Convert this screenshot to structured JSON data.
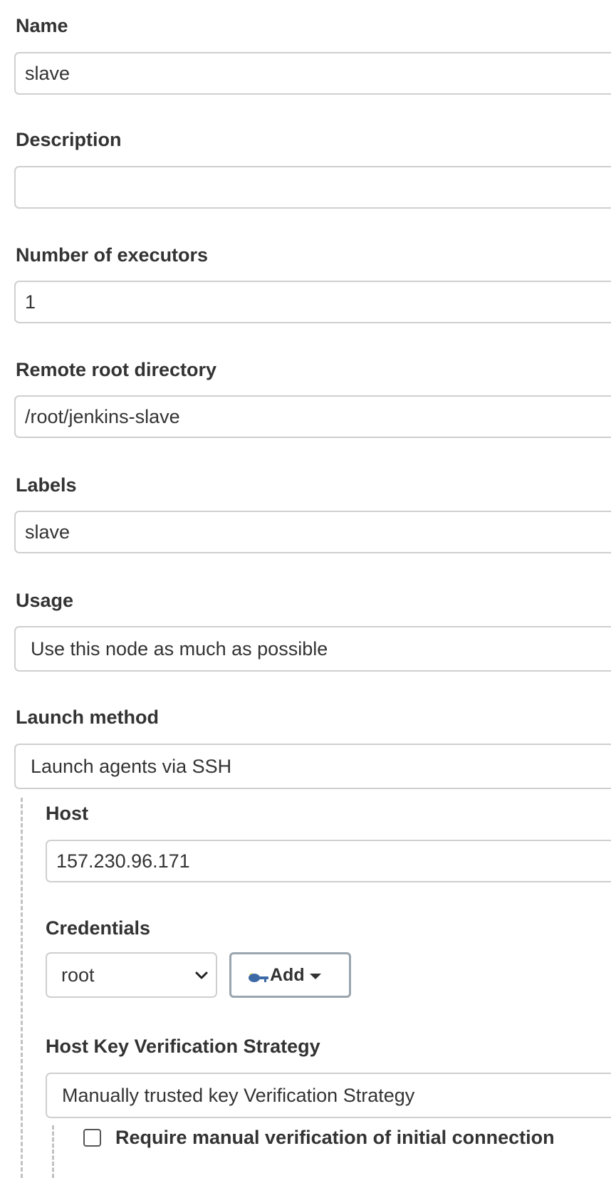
{
  "fields": {
    "name": {
      "label": "Name",
      "value": "slave"
    },
    "description": {
      "label": "Description",
      "value": ""
    },
    "executors": {
      "label": "Number of executors",
      "value": "1"
    },
    "remote_root": {
      "label": "Remote root directory",
      "value": "/root/jenkins-slave"
    },
    "labels": {
      "label": "Labels",
      "value": "slave"
    },
    "usage": {
      "label": "Usage",
      "selected": "Use this node as much as possible"
    },
    "launch_method": {
      "label": "Launch method",
      "selected": "Launch agents via SSH"
    }
  },
  "ssh": {
    "host": {
      "label": "Host",
      "value": "157.230.96.171"
    },
    "credentials": {
      "label": "Credentials",
      "selected": "root",
      "add_button": "Add",
      "add_icon": "key-icon"
    },
    "host_key_strategy": {
      "label": "Host Key Verification Strategy",
      "selected": "Manually trusted key Verification Strategy"
    },
    "manual_verification": {
      "label": "Require manual verification of initial connection",
      "checked": false
    }
  }
}
